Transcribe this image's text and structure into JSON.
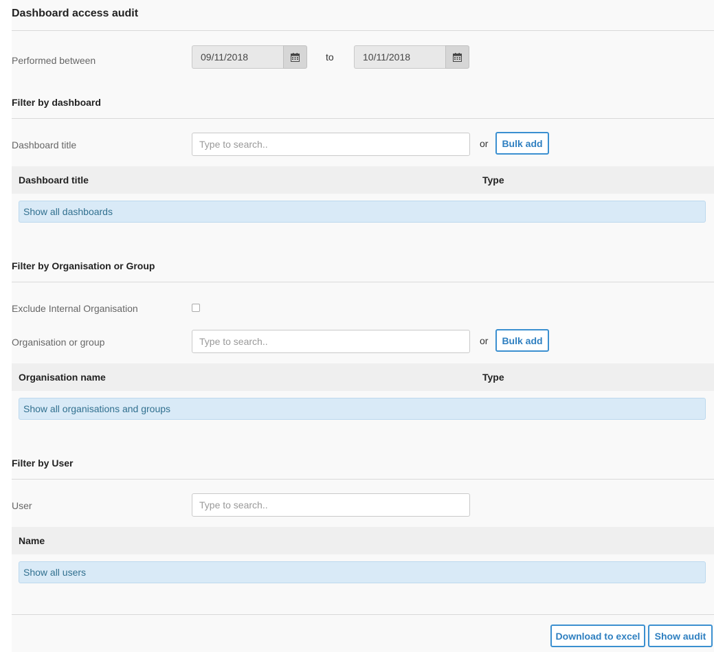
{
  "page": {
    "title": "Dashboard access audit"
  },
  "date_range": {
    "label": "Performed between",
    "from": "09/11/2018",
    "to_label": "to",
    "to": "10/11/2018",
    "icon": "calendar-icon"
  },
  "dashboard_filter": {
    "section_title": "Filter by dashboard",
    "field_label": "Dashboard title",
    "search_placeholder": "Type to search..",
    "or_label": "or",
    "bulk_add_label": "Bulk add",
    "columns": [
      "Dashboard title",
      "Type"
    ],
    "empty_row": "Show all dashboards"
  },
  "org_filter": {
    "section_title": "Filter by Organisation or Group",
    "exclude_label": "Exclude Internal Organisation",
    "exclude_checked": false,
    "field_label": "Organisation or group",
    "search_placeholder": "Type to search..",
    "or_label": "or",
    "bulk_add_label": "Bulk add",
    "columns": [
      "Organisation name",
      "Type"
    ],
    "empty_row": "Show all organisations and groups"
  },
  "user_filter": {
    "section_title": "Filter by User",
    "field_label": "User",
    "search_placeholder": "Type to search..",
    "columns": [
      "Name"
    ],
    "empty_row": "Show all users"
  },
  "footer": {
    "download_label": "Download to excel",
    "show_audit_label": "Show audit"
  },
  "colors": {
    "accent": "#3a8fd0",
    "info_bg": "#d9eaf7",
    "info_text": "#31708f"
  }
}
